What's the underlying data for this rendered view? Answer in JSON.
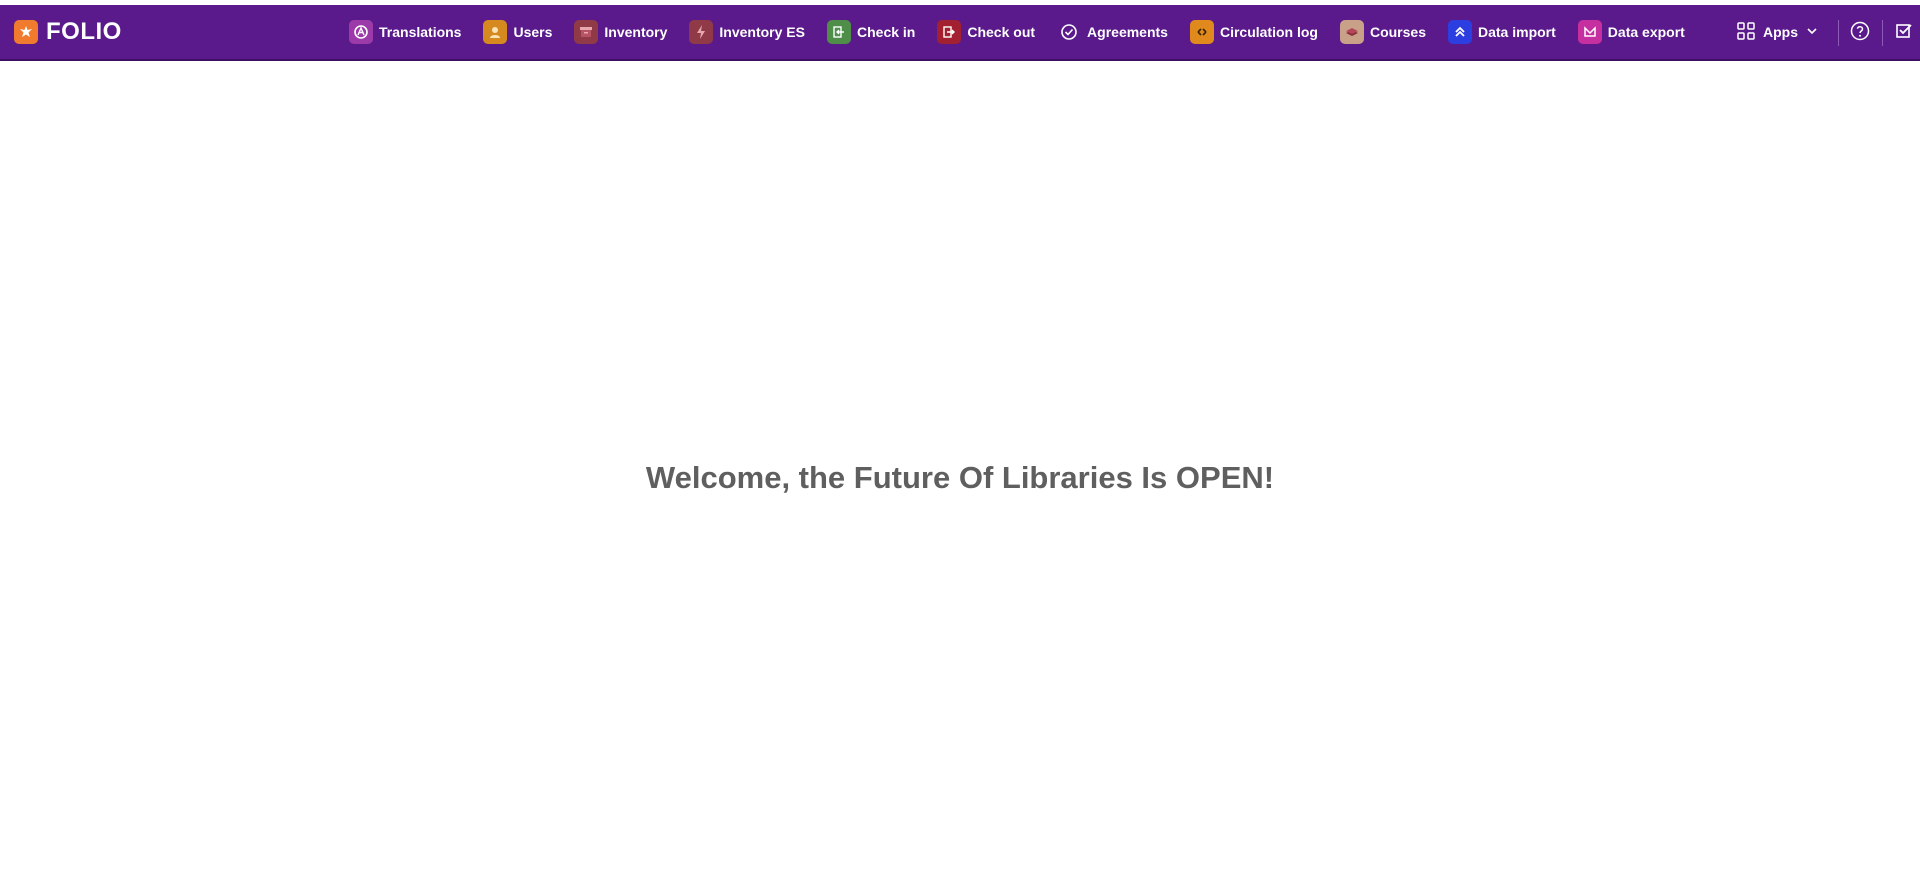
{
  "header": {
    "logo_text": "FOLIO",
    "apps": [
      {
        "label": "Translations",
        "icon": "translations-icon",
        "color": "#9b3aa8"
      },
      {
        "label": "Users",
        "icon": "users-icon",
        "color": "#d6891f"
      },
      {
        "label": "Inventory",
        "icon": "inventory-icon",
        "color": "#8f3a46"
      },
      {
        "label": "Inventory ES",
        "icon": "inventory-es-icon",
        "color": "#8f3a46"
      },
      {
        "label": "Check in",
        "icon": "check-in-icon",
        "color": "#4e8e48"
      },
      {
        "label": "Check out",
        "icon": "check-out-icon",
        "color": "#a32030"
      },
      {
        "label": "Agreements",
        "icon": "agreements-icon",
        "color": "#ffffff"
      },
      {
        "label": "Circulation log",
        "icon": "circulation-log-icon",
        "color": "#e08a1e"
      },
      {
        "label": "Courses",
        "icon": "courses-icon",
        "color": "#c9a188"
      },
      {
        "label": "Data import",
        "icon": "data-import-icon",
        "color": "#2c3ee0"
      },
      {
        "label": "Data export",
        "icon": "data-export-icon",
        "color": "#c52fa0"
      }
    ],
    "apps_menu_label": "Apps"
  },
  "main": {
    "welcome_text": "Welcome, the Future Of Libraries Is OPEN!"
  },
  "colors": {
    "navbar_bg": "#5b1a8c",
    "logo_accent": "#f07a2e",
    "welcome_text": "#5f5f5f"
  }
}
